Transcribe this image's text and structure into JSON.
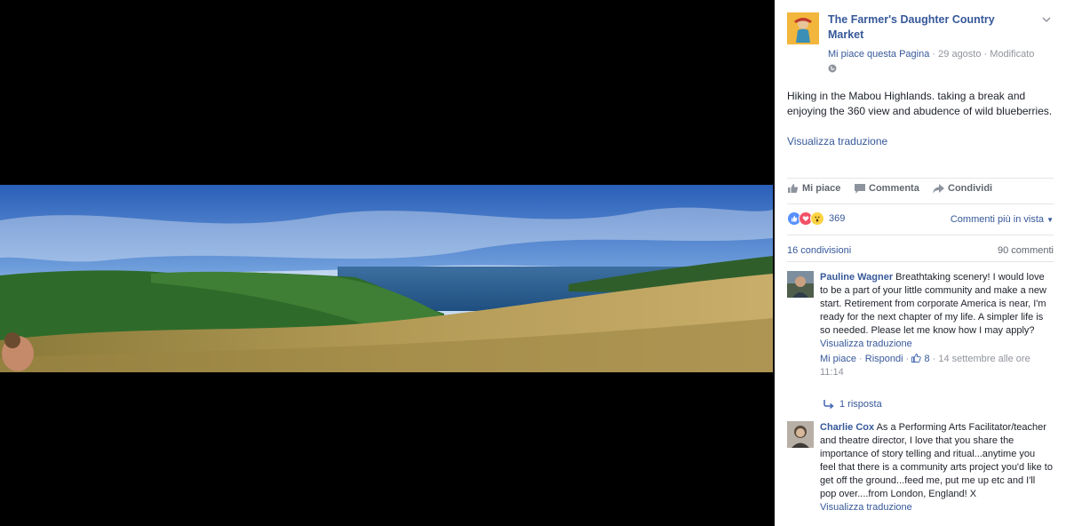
{
  "post": {
    "page_name": "The Farmer's Daughter Country Market",
    "like_page": "Mi piace questa Pagina",
    "date": "29 agosto",
    "edited": "Modificato",
    "sep": "·",
    "text": "Hiking in the Mabou Highlands. taking a break and enjoying the 360 view and abudence of wild blueberries.",
    "translate": "Visualizza traduzione"
  },
  "actions": {
    "like": "Mi piace",
    "comment": "Commenta",
    "share": "Condividi"
  },
  "stats": {
    "reactions_count": "369",
    "sort_label": "Commenti più in vista",
    "shares": "16 condivisioni",
    "comments": "90 commenti"
  },
  "comments": [
    {
      "author": "Pauline Wagner",
      "text": "Breathtaking scenery! I would love to be a part of your little community and make a new start. Retirement from corporate America is near, I'm ready for the next chapter of my life. A simpler life is so needed. Please let me know how I may apply?",
      "translate": "Visualizza traduzione",
      "like": "Mi piace",
      "reply": "Rispondi",
      "likes": "8",
      "time": "14 settembre alle ore 11:14",
      "replies_link": "1 risposta"
    },
    {
      "author": "Charlie Cox",
      "text": "As a Performing Arts Facilitator/teacher and theatre director, I love that you share the importance of story telling and ritual...anytime you feel that there is a community arts project you'd like to get off the ground...feed me, put me up etc and I'll pop over....from London, England! X",
      "translate": "Visualizza traduzione"
    }
  ],
  "colors": {
    "link": "#365899",
    "muted": "#90949c",
    "text": "#1d2129",
    "like_blue": "#5890ff",
    "love_red": "#f25268",
    "wow_yellow": "#fcd343"
  },
  "icons": [
    "chevron-down-icon",
    "globe-icon",
    "like-icon",
    "comment-icon",
    "share-icon",
    "reply-arrow-icon",
    "thumbs-up-icon"
  ]
}
